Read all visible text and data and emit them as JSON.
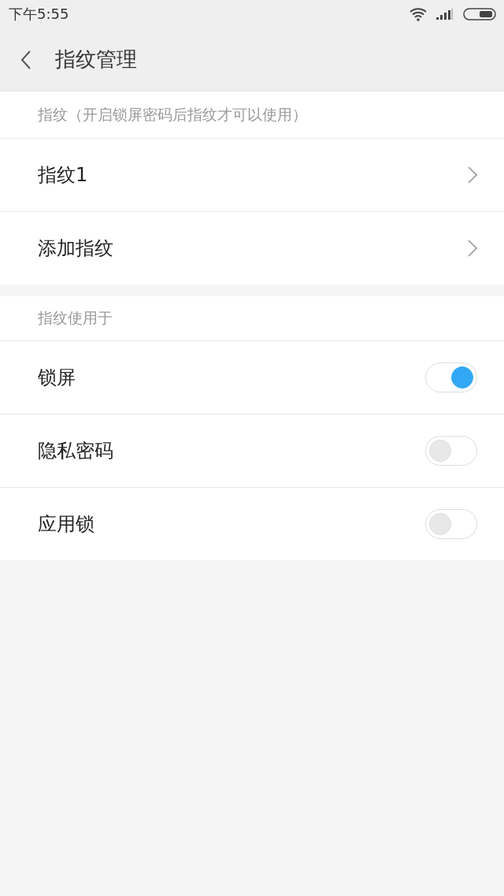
{
  "status_bar": {
    "time": "下午5:55"
  },
  "header": {
    "title": "指纹管理"
  },
  "sections": [
    {
      "title": "指纹（开启锁屏密码后指纹才可以使用）",
      "items": [
        {
          "kind": "link",
          "label": "指纹1"
        },
        {
          "kind": "link",
          "label": "添加指纹"
        }
      ]
    },
    {
      "title": "指纹使用于",
      "items": [
        {
          "kind": "switch",
          "label": "锁屏",
          "on": true
        },
        {
          "kind": "switch",
          "label": "隐私密码",
          "on": false
        },
        {
          "kind": "switch",
          "label": "应用锁",
          "on": false
        }
      ]
    }
  ]
}
